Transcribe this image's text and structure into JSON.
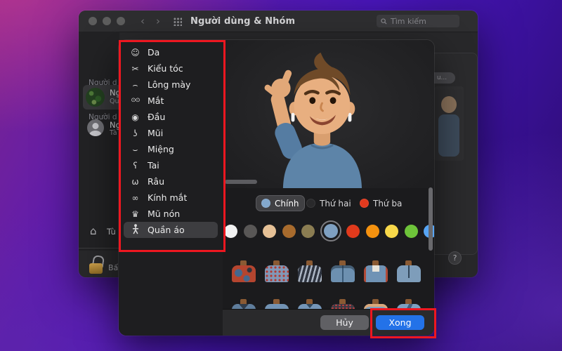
{
  "annotation_color": "#ee1720",
  "window": {
    "title": "Người dùng & Nhóm",
    "toolbar": {
      "back_icon": "‹",
      "forward_icon": "›",
      "search_placeholder": "Tìm kiếm"
    },
    "sidebar": {
      "section1_header": "Người d",
      "current_user": {
        "name": "Ng",
        "detail": "Qu"
      },
      "section2_header": "Người d",
      "other_user": {
        "name": "Ng",
        "detail": "Tà"
      },
      "login_options": {
        "label": "Tù"
      },
      "add_button": "+",
      "remove_button": "−",
      "lock_hint": "Bấ"
    },
    "right_panel": {
      "edit_button": "u...",
      "help_button": "?"
    }
  },
  "editor": {
    "categories": [
      {
        "icon": "smiley-face-icon",
        "glyph": "☺",
        "label": "Da",
        "selected": false
      },
      {
        "icon": "hair-icon",
        "glyph": "✂",
        "label": "Kiểu tóc",
        "selected": false
      },
      {
        "icon": "eyebrow-icon",
        "glyph": "⌢",
        "label": "Lông mày",
        "selected": false
      },
      {
        "icon": "eyes-icon",
        "glyph": "⊙⊙",
        "label": "Mắt",
        "selected": false
      },
      {
        "icon": "head-icon",
        "glyph": "◉",
        "label": "Đầu",
        "selected": false
      },
      {
        "icon": "nose-icon",
        "glyph": "ʖ",
        "label": "Mũi",
        "selected": false
      },
      {
        "icon": "mouth-icon",
        "glyph": "⌣",
        "label": "Miệng",
        "selected": false
      },
      {
        "icon": "ear-icon",
        "glyph": "ʕ",
        "label": "Tai",
        "selected": false
      },
      {
        "icon": "mustache-icon",
        "glyph": "ω",
        "label": "Râu",
        "selected": false
      },
      {
        "icon": "glasses-icon",
        "glyph": "∞",
        "label": "Kính mắt",
        "selected": false
      },
      {
        "icon": "hat-icon",
        "glyph": "♛",
        "label": "Mũ nón",
        "selected": false
      },
      {
        "icon": "person-icon",
        "glyph": "",
        "label": "Quần áo",
        "selected": true
      }
    ],
    "color_tabs": [
      {
        "label": "Chính",
        "dot_color": "#83a8cd",
        "selected": true
      },
      {
        "label": "Thứ hai",
        "dot_color": "#29292b",
        "selected": false
      },
      {
        "label": "Thứ ba",
        "dot_color": "#e23a1e",
        "selected": false
      }
    ],
    "skin_swatches": [
      {
        "color": "#f2f2f2",
        "selected": false
      },
      {
        "color": "#595756",
        "selected": false
      },
      {
        "color": "#e6c196",
        "selected": false
      },
      {
        "color": "#a86b2d",
        "selected": false
      },
      {
        "color": "#8b7d52",
        "selected": false
      },
      {
        "color": "#7fa0c1",
        "selected": true
      },
      {
        "color": "#e03a1c",
        "selected": false
      },
      {
        "color": "#f5920f",
        "selected": false
      },
      {
        "color": "#f8d84a",
        "selected": false
      },
      {
        "color": "#6ec43a",
        "selected": false
      },
      {
        "color": "#57a5f5",
        "selected": false
      }
    ],
    "clothing_options": [
      {
        "style": "patterned-tee"
      },
      {
        "style": "floral-blouse"
      },
      {
        "style": "striped-poncho"
      },
      {
        "style": "hoodie"
      },
      {
        "style": "trim-tunic"
      },
      {
        "style": "zip-shirt"
      },
      {
        "style": "collar-top"
      },
      {
        "style": "plain-top"
      },
      {
        "style": "vneck-top"
      },
      {
        "style": "yoke-top"
      },
      {
        "style": "offshoulder-top"
      },
      {
        "style": "strap-top"
      }
    ],
    "footer": {
      "cancel_label": "Hủy",
      "done_label": "Xong",
      "done_color": "#2372e8"
    }
  }
}
